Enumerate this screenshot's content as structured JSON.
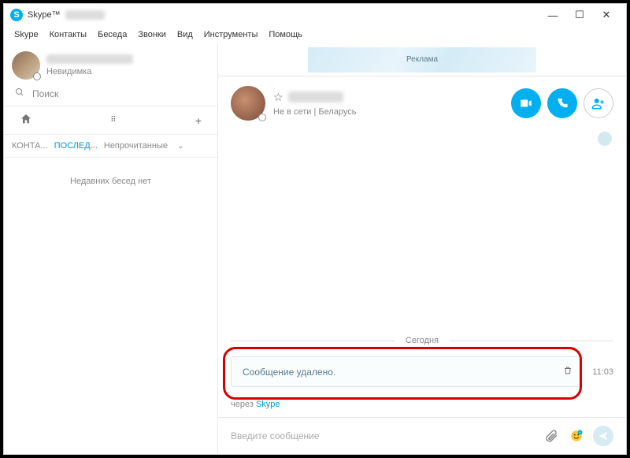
{
  "titlebar": {
    "app": "Skype™"
  },
  "menu": {
    "items": [
      "Skype",
      "Контакты",
      "Беседа",
      "Звонки",
      "Вид",
      "Инструменты",
      "Помощь"
    ]
  },
  "sidebar": {
    "user_status": "Невидимка",
    "search_placeholder": "Поиск",
    "tabs": {
      "contacts": "КОНТА...",
      "recent": "ПОСЛЕД...",
      "unread": "Непрочитанные"
    },
    "empty": "Недавних бесед нет"
  },
  "ad": {
    "label": "Реклама"
  },
  "contact": {
    "status_line": "Не в сети  |  Беларусь"
  },
  "chat": {
    "divider": "Сегодня",
    "deleted": "Сообщение удалено.",
    "time": "11:03"
  },
  "via": {
    "prefix": "через ",
    "link": "Skype"
  },
  "compose": {
    "placeholder": "Введите сообщение"
  },
  "icons": {
    "video": "video-icon",
    "call": "call-icon",
    "add": "add-contact-icon",
    "attach": "paperclip-icon",
    "emoji": "emoji-icon",
    "send": "send-icon",
    "home": "home-icon",
    "dialpad": "dialpad-icon",
    "plus": "plus-icon",
    "search": "search-icon",
    "trash": "trash-icon",
    "star": "star-icon",
    "globe": "globe-icon"
  }
}
